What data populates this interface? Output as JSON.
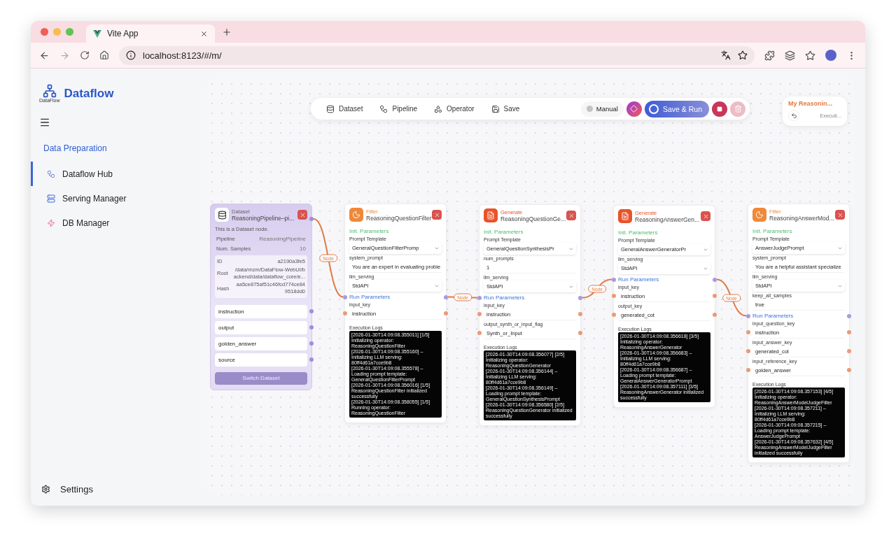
{
  "browser": {
    "tab_title": "Vite App",
    "url": "localhost:8123/#/m/"
  },
  "sidebar": {
    "brand": "Dataflow",
    "brand_caption": "DataFlow",
    "section": "Data Preparation",
    "items": [
      {
        "label": "Dataflow Hub",
        "selected": true
      },
      {
        "label": "Serving Manager",
        "selected": false
      },
      {
        "label": "DB Manager",
        "selected": false
      }
    ],
    "settings": "Settings"
  },
  "toolbar": {
    "items": [
      "Dataset",
      "Pipeline",
      "Operator",
      "Save"
    ],
    "manual": {
      "label": "Manual",
      "on": false
    },
    "run_label": "Save & Run",
    "delete_disabled": true
  },
  "pipeline_card": {
    "title": "My Reasonin...",
    "status": "Executi..."
  },
  "edge_labels": [
    "Node",
    "Node",
    "Node",
    "Node"
  ],
  "nodes": [
    {
      "kind": "dataset",
      "category": "Dataset",
      "title": "ReasoningPipeline–pi...",
      "description": "This is a Dataset node.",
      "stats": [
        {
          "label": "Pipeline",
          "value": "ReasoningPipeline"
        },
        {
          "label": "Num. Samples",
          "value": "10"
        }
      ],
      "meta": [
        {
          "label": "ID",
          "value": "a2190a3fe5"
        },
        {
          "label": "Root",
          "value": "/data/mzm/DataFlow-WebUI/backend/data/dataflow_core/e..."
        },
        {
          "label": "Hash",
          "value": "aa5ce875af51c46fcd774ce849518dd0"
        }
      ],
      "fields": [
        "instruction",
        "output",
        "golden_answer",
        "source"
      ],
      "button": "Switch Dataset"
    },
    {
      "kind": "operator",
      "category": "Filter",
      "color": "#f0883a",
      "title": "ReasoningQuestionFilter",
      "init_title": "Init. Parameters",
      "run_title": "Run Parameters",
      "logs_title": "Execution Logs",
      "init_params": [
        {
          "kind": "select",
          "label": "Prompt Template",
          "value": "GeneralQuestionFilterPromp"
        },
        {
          "kind": "text",
          "label": "system_prompt",
          "value": "You are an expert in evaluating proble"
        },
        {
          "kind": "select",
          "label": "llm_serving",
          "value": "StdAPI"
        }
      ],
      "run_params": [
        {
          "label": "input_key",
          "value": "instruction"
        }
      ],
      "logs": [
        "[2026-01-30T14:09:08.355011] [1/5] Initializing operator: ReasoningQuestionFilter",
        "[2026-01-30T14:09:08.355160] – Initializing LLM serving: 80ff4d61a7cce9b8",
        "[2026-01-30T14:09:08.355578] – Loading prompt template: GeneralQuestionFilterPrompt",
        "[2026-01-30T14:09:08.356016] [1/5] ReasoningQuestionFilter initialized successfully",
        "[2026-01-30T14:09:08.358055] [1/5] Running operator: ReasoningQuestionFilter"
      ]
    },
    {
      "kind": "operator",
      "category": "Generate",
      "color": "#e8542a",
      "title": "ReasoningQuestionGe...",
      "init_title": "Init. Parameters",
      "run_title": "Run Parameters",
      "logs_title": "Execution Logs",
      "init_params": [
        {
          "kind": "select",
          "label": "Prompt Template",
          "value": "GeneralQuestionSynthesisPr"
        },
        {
          "kind": "text",
          "label": "num_prompts",
          "value": "1"
        },
        {
          "kind": "select",
          "label": "llm_serving",
          "value": "StdAPI"
        }
      ],
      "run_params": [
        {
          "label": "input_key",
          "value": "instruction"
        },
        {
          "label": "output_synth_or_input_flag",
          "value": "Synth_or_Input"
        }
      ],
      "logs": [
        "[2026-01-30T14:09:08.356077] [2/5] Initializing operator: ReasoningQuestionGenerator",
        "[2026-01-30T14:09:08.356144] – Initializing LLM serving: 80ff4d61a7cce9b8",
        "[2026-01-30T14:09:08.356149] – Loading prompt template: GeneralQuestionSynthesisPrompt",
        "[2026-01-30T14:09:08.356580] [2/5] ReasoningQuestionGenerator initialized successfully"
      ]
    },
    {
      "kind": "operator",
      "category": "Generate",
      "color": "#e8542a",
      "title": "ReasoningAnswerGen...",
      "init_title": "Init. Parameters",
      "run_title": "Run Parameters",
      "logs_title": "Execution Logs",
      "init_params": [
        {
          "kind": "select",
          "label": "Prompt Template",
          "value": "GeneralAnswerGeneratorPr"
        },
        {
          "kind": "select",
          "label": "llm_serving",
          "value": "StdAPI"
        }
      ],
      "run_params": [
        {
          "label": "input_key",
          "value": "instruction"
        },
        {
          "label": "output_key",
          "value": "generated_cot"
        }
      ],
      "logs": [
        "[2026-01-30T14:09:08.356618] [3/5] Initializing operator: ReasoningAnswerGenerator",
        "[2026-01-30T14:09:08.356683] – Initializing LLM serving: 80ff4d61a7cce9b8",
        "[2026-01-30T14:09:08.356687] – Loading prompt template: GeneralAnswerGeneratorPrompt",
        "[2026-01-30T14:09:08.357111] [3/5] ReasoningAnswerGenerator initialized successfully"
      ]
    },
    {
      "kind": "operator",
      "category": "Filter",
      "color": "#f0883a",
      "title": "ReasoningAnswerMod...",
      "init_title": "Init. Parameters",
      "run_title": "Run Parameters",
      "logs_title": "Execution Logs",
      "init_params": [
        {
          "kind": "select",
          "label": "Prompt Template",
          "value": "AnswerJudgePrompt"
        },
        {
          "kind": "text",
          "label": "system_prompt",
          "value": "You are a helpful assistant specialize"
        },
        {
          "kind": "select",
          "label": "llm_serving",
          "value": "StdAPI"
        },
        {
          "kind": "text",
          "label": "keep_all_samples",
          "value": "true"
        }
      ],
      "run_params": [
        {
          "label": "input_question_key",
          "value": "instruction"
        },
        {
          "label": "input_answer_key",
          "value": "generated_cot"
        },
        {
          "label": "input_reference_key",
          "value": "golden_answer"
        }
      ],
      "logs": [
        "[2026-01-30T14:09:08.357153] [4/5] Initializing operator: ReasoningAnswerModelJudgeFilter",
        "[2026-01-30T14:09:08.357211] – Initializing LLM serving: 80ff4d61a7cce9b8",
        "[2026-01-30T14:09:08.357215] – Loading prompt template: AnswerJudgePrompt",
        "[2026-01-30T14:09:08.357632] [4/5] ReasoningAnswerModelJudgeFilter initialized successfully"
      ]
    }
  ]
}
